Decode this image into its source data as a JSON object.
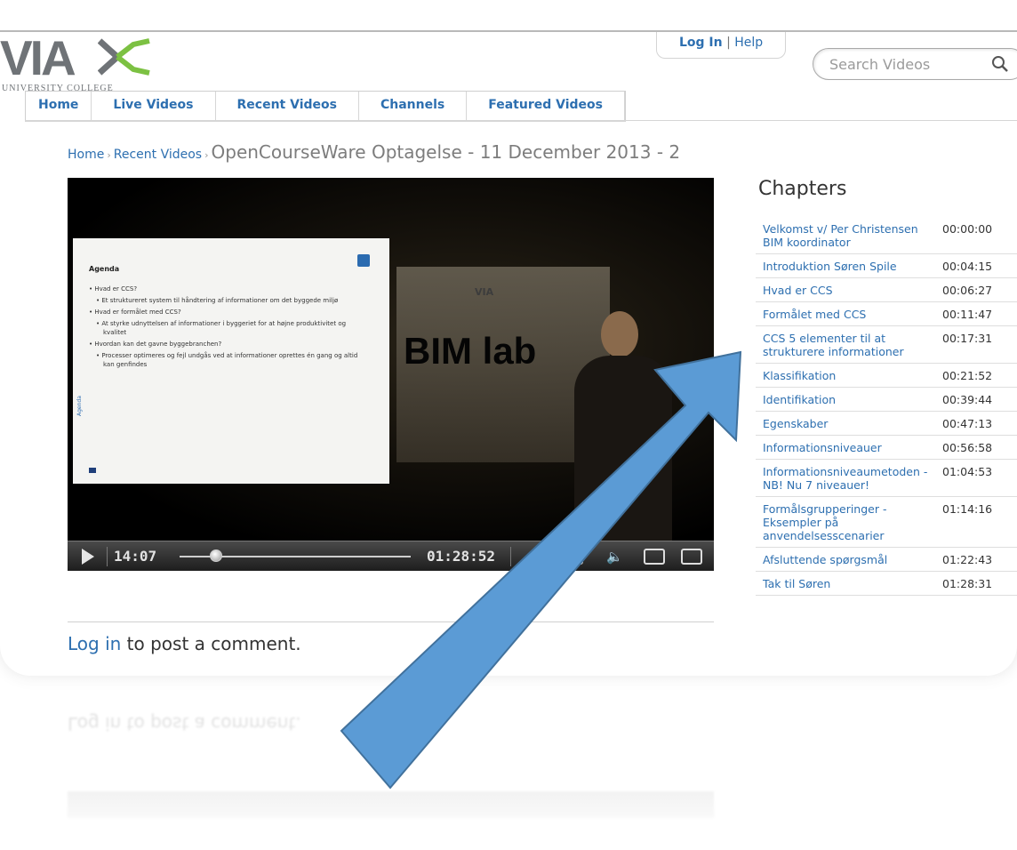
{
  "logo": {
    "text": "VIA",
    "subtitle": "UNIVERSITY COLLEGE"
  },
  "header": {
    "login_label": "Log In",
    "separator": "|",
    "help_label": "Help"
  },
  "search": {
    "placeholder": "Search Videos"
  },
  "nav": {
    "items": [
      {
        "label": "Home"
      },
      {
        "label": "Live Videos"
      },
      {
        "label": "Recent Videos"
      },
      {
        "label": "Channels"
      },
      {
        "label": "Featured Videos"
      }
    ]
  },
  "breadcrumb": {
    "home": "Home",
    "sep": "›",
    "recent": "Recent Videos",
    "current": "OpenCourseWare Optagelse - 11 December 2013 - 2"
  },
  "video": {
    "slide": {
      "title": "Agenda",
      "bullets": [
        "Hvad er CCS?",
        "Et struktureret system til håndtering af informationer om det byggede miljø",
        "Hvad er formålet med CCS?",
        "At styrke udnyttelsen af informationer i byggeriet for at højne produktivitet og kvalitet",
        "Hvordan kan det gavne byggebranchen?",
        "Processer optimeres og fejl undgås ved at informationer oprettes én gang og altid kan genfindes"
      ],
      "side_label": "Agenda"
    },
    "room_sign": "BIM lab",
    "room_logo": "VIA",
    "current_time": "14:07",
    "duration": "01:28:52",
    "progress_fraction": 0.158
  },
  "comment": {
    "link": "Log in",
    "text": " to post a comment."
  },
  "chapters": {
    "title": "Chapters",
    "items": [
      {
        "label": "Velkomst v/ Per Christensen BIM koordinator",
        "time": "00:00:00"
      },
      {
        "label": "Introduktion Søren Spile",
        "time": "00:04:15"
      },
      {
        "label": "Hvad er CCS",
        "time": "00:06:27"
      },
      {
        "label": "Formålet med CCS",
        "time": "00:11:47"
      },
      {
        "label": "CCS 5 elementer til at strukturere informationer",
        "time": "00:17:31"
      },
      {
        "label": "Klassifikation",
        "time": "00:21:52"
      },
      {
        "label": "Identifikation",
        "time": "00:39:44"
      },
      {
        "label": "Egenskaber",
        "time": "00:47:13"
      },
      {
        "label": "Informationsniveauer",
        "time": "00:56:58"
      },
      {
        "label": "Informationsniveaumetoden - NB! Nu 7 niveauer!",
        "time": "01:04:53"
      },
      {
        "label": "Formålsgrupperinger - Eksempler på anvendelsesscenarier",
        "time": "01:14:16"
      },
      {
        "label": "Afsluttende spørgsmål",
        "time": "01:22:43"
      },
      {
        "label": "Tak til Søren",
        "time": "01:28:31"
      }
    ]
  },
  "colors": {
    "link": "#2d6fb0",
    "logo_green": "#7cc142",
    "arrow": "#5b9bd5",
    "arrow_border": "#41719c"
  }
}
